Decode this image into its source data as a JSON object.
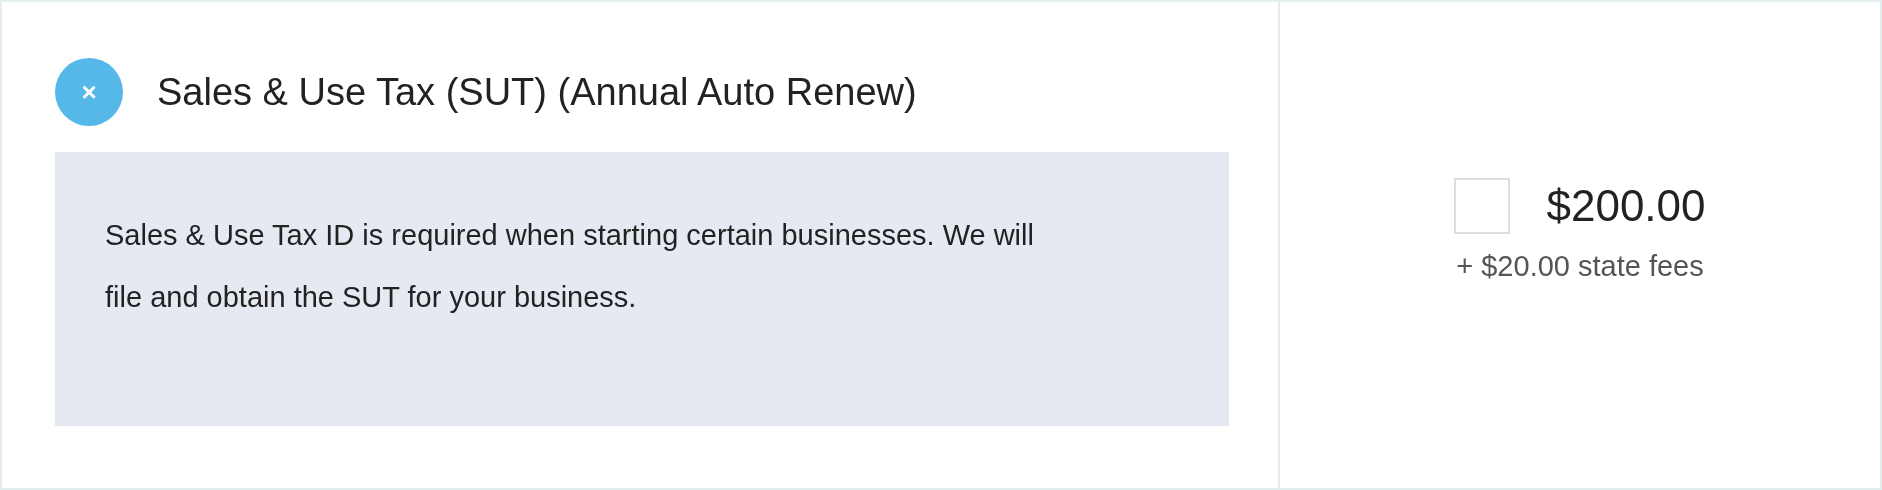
{
  "service": {
    "title": "Sales & Use Tax (SUT) (Annual Auto Renew)",
    "remove_icon": "×",
    "description": "Sales & Use Tax ID is required when starting certain businesses. We will file and obtain the SUT for your business."
  },
  "pricing": {
    "checked": false,
    "price": "$200.00",
    "fees": "+ $20.00 state fees"
  }
}
